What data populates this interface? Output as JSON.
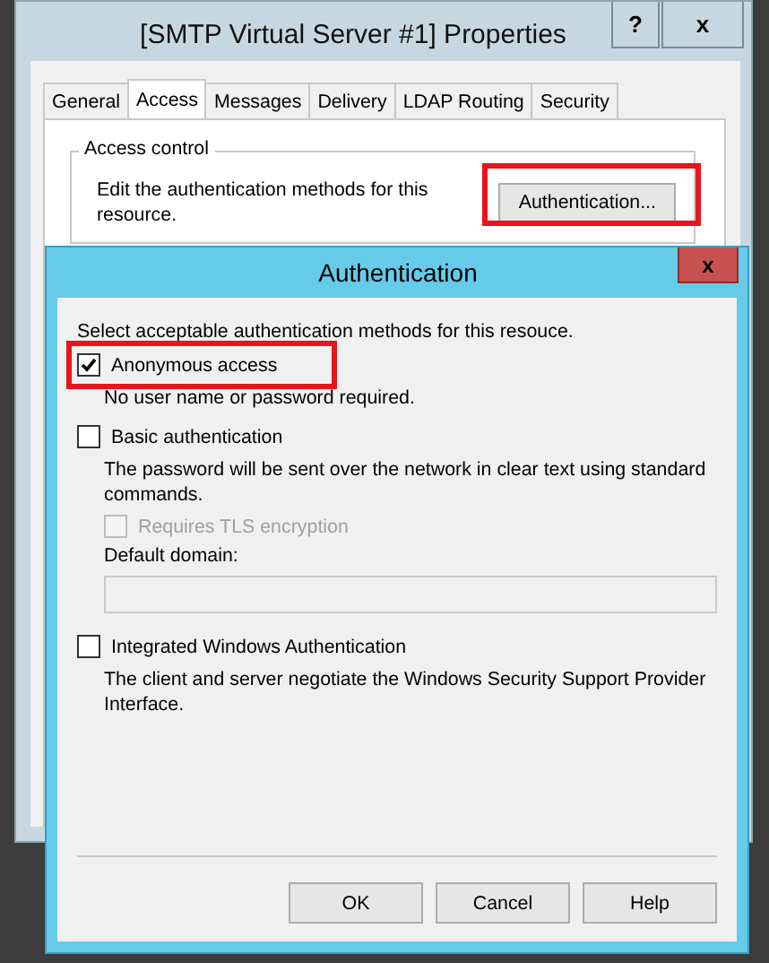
{
  "properties_window": {
    "title": "[SMTP Virtual Server #1] Properties",
    "help_button": "?",
    "close_button": "x",
    "tabs": [
      {
        "label": "General",
        "selected": false
      },
      {
        "label": "Access",
        "selected": true
      },
      {
        "label": "Messages",
        "selected": false
      },
      {
        "label": "Delivery",
        "selected": false
      },
      {
        "label": "LDAP Routing",
        "selected": false
      },
      {
        "label": "Security",
        "selected": false
      }
    ],
    "access_control": {
      "legend": "Access control",
      "description": "Edit the authentication methods for this resource.",
      "button": {
        "label": "Authentication...",
        "highlighted": true
      }
    }
  },
  "auth_dialog": {
    "title": "Authentication",
    "close_button": "x",
    "intro": "Select acceptable authentication methods for this resouce.",
    "options": [
      {
        "kind": "checkbox",
        "label": "Anonymous access",
        "checked": true,
        "disabled": false,
        "highlighted": true,
        "description": "No user name or password required."
      },
      {
        "kind": "checkbox",
        "label": "Basic authentication",
        "checked": false,
        "disabled": false,
        "highlighted": false,
        "description": "The password will be sent over the network in clear text using standard commands.",
        "children": [
          {
            "kind": "checkbox",
            "label": "Requires TLS encryption",
            "checked": false,
            "disabled": true,
            "highlighted": false
          },
          {
            "kind": "field",
            "label": "Default domain:",
            "disabled": true
          }
        ]
      },
      {
        "kind": "checkbox",
        "label": "Integrated Windows Authentication",
        "checked": false,
        "disabled": false,
        "highlighted": false,
        "description": "The client and server negotiate the Windows Security Support Provider Interface."
      }
    ],
    "buttons": [
      "OK",
      "Cancel",
      "Help"
    ]
  }
}
